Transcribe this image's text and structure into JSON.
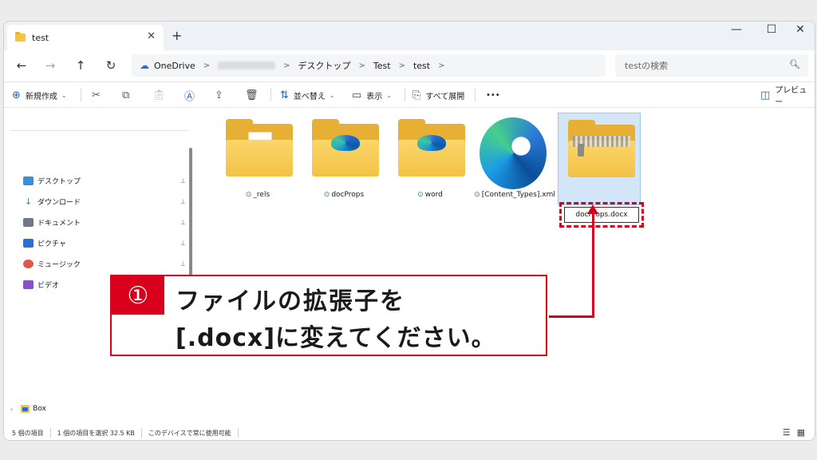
{
  "tab": {
    "title": "test",
    "close": "✕",
    "new": "+"
  },
  "window_controls": {
    "minimize": "—",
    "maximize": "☐",
    "close": "✕"
  },
  "nav": {
    "back": "←",
    "forward": "→",
    "up": "↑",
    "refresh": "↻"
  },
  "address": {
    "segments": [
      "OneDrive",
      "デスクトップ",
      "Test",
      "test"
    ],
    "separator": ">"
  },
  "search": {
    "placeholder": "testの検索"
  },
  "toolbar": {
    "new_label": "新規作成",
    "sort_label": "並べ替え",
    "view_label": "表示",
    "expand_all_label": "すべて展開",
    "more_label": "•••",
    "preview_label": "プレビュー"
  },
  "sidebar": {
    "items": [
      {
        "label": "デスクトップ",
        "icon": "desktop-icon",
        "color": "#3a8fd8"
      },
      {
        "label": "ダウンロード",
        "icon": "download-icon",
        "color": "#2a9d5a"
      },
      {
        "label": "ドキュメント",
        "icon": "document-icon",
        "color": "#6c7a89"
      },
      {
        "label": "ピクチャ",
        "icon": "picture-icon",
        "color": "#2d6fd1"
      },
      {
        "label": "ミュージック",
        "icon": "music-icon",
        "color": "#e0584a"
      },
      {
        "label": "ビデオ",
        "icon": "video-icon",
        "color": "#8a4fd1"
      }
    ],
    "box_label": "Box",
    "pin": "📌"
  },
  "files": [
    {
      "name": "_rels",
      "type": "folder-document"
    },
    {
      "name": "docProps",
      "type": "folder-edge"
    },
    {
      "name": "word",
      "type": "folder-edge"
    },
    {
      "name": "[Content_Types].xml",
      "type": "edge-file"
    },
    {
      "name": "docProps.docx",
      "type": "zip-folder",
      "selected": true
    }
  ],
  "sync_check": "⊙",
  "callout": {
    "number": "①",
    "line1": "ファイルの拡張子を",
    "line2": "[.docx]に変えてください。"
  },
  "status": {
    "count": "5 個の項目",
    "selection": "1 個の項目を選択  32.5 KB",
    "availability": "このデバイスで常に使用可能"
  },
  "colors": {
    "accent_red": "#d9001b",
    "selection_bg": "#d3e6f8"
  }
}
